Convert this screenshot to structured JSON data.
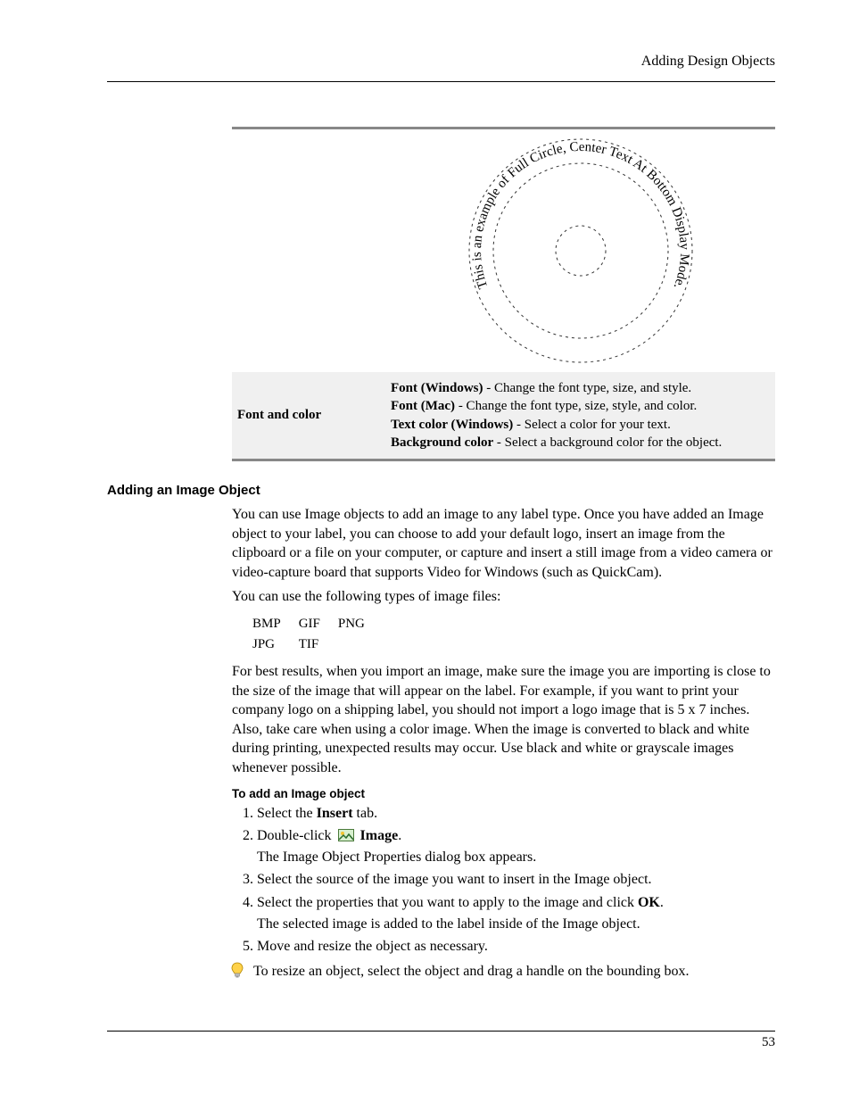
{
  "header": {
    "running_head": "Adding Design Objects"
  },
  "table": {
    "font_and_color": {
      "label": "Font and color",
      "lines": [
        {
          "bold": "Font (Windows)",
          "rest": " - Change the font type, size, and style."
        },
        {
          "bold": "Font (Mac)",
          "rest": " - Change the font type, size, style, and color."
        },
        {
          "bold": "Text color (Windows)",
          "rest": " - Select a color for your text."
        },
        {
          "bold": "Background color",
          "rest": " - Select a background color for the object."
        }
      ]
    }
  },
  "circle_text": "This is an example of Full Circle, Center Text At Bottom Display Mode.",
  "section": {
    "heading": "Adding an Image Object",
    "p1": "You can use Image objects to add an image to any label type. Once you have added an Image object to your label, you can choose to add your default logo, insert an image from the clipboard or a file on your computer, or capture and insert a still image from a video camera or video-capture board that supports Video for Windows (such as QuickCam).",
    "p2": "You can use the following types of image files:",
    "types": [
      [
        "BMP",
        "GIF",
        "PNG"
      ],
      [
        "JPG",
        "TIF",
        ""
      ]
    ],
    "p3": "For best results, when you import an image, make sure the image you are importing is close to the size of the image that will appear on the label. For example, if you want to print your company logo on a shipping label, you should not import a logo image that is 5 x 7 inches. Also, take care when using a color image. When the image is converted to black and white during printing, unexpected results may occur. Use black and white or grayscale images whenever possible.",
    "subheading": "To add an Image object",
    "steps": {
      "s1_pre": "Select the ",
      "s1_bold": "Insert",
      "s1_post": " tab.",
      "s2_pre": "Double-click ",
      "s2_bold": "Image",
      "s2_post": ".",
      "s2_sub": "The Image Object Properties dialog box appears.",
      "s3": "Select the source of the image you want to insert in the Image object.",
      "s4_pre": "Select the properties that you want to apply to the image and click ",
      "s4_bold": "OK",
      "s4_post": ".",
      "s4_sub": "The selected image is added to the label inside of the Image object.",
      "s5": "Move and resize the object as necessary."
    },
    "tip": "To resize an object, select the object and drag a handle on the bounding box."
  },
  "footer": {
    "page": "53"
  }
}
